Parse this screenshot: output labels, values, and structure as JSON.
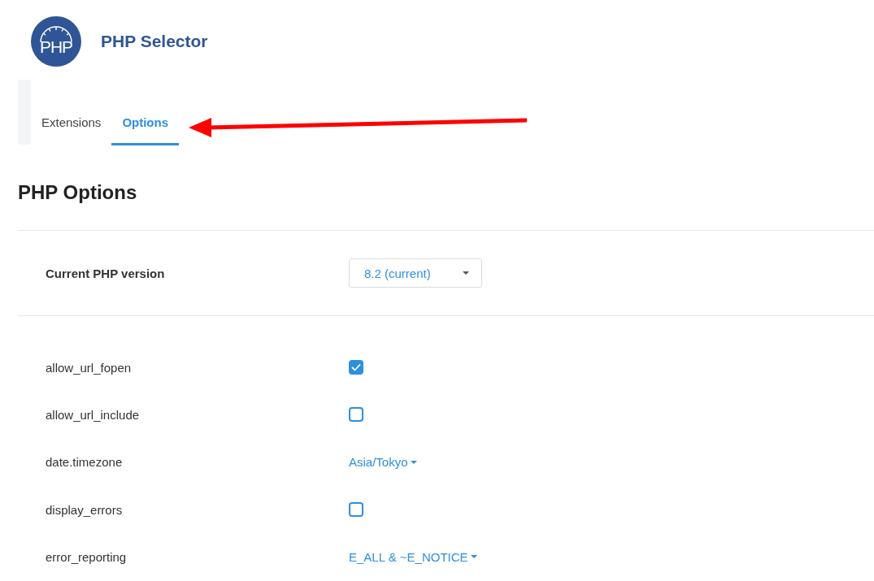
{
  "header": {
    "logo_text": "PHP",
    "title": "PHP Selector"
  },
  "tabs": [
    {
      "label": "Extensions",
      "selected": false
    },
    {
      "label": "Options",
      "selected": true
    }
  ],
  "section_title": "PHP Options",
  "version": {
    "label": "Current PHP version",
    "value": "8.2 (current)"
  },
  "options": [
    {
      "name": "allow_url_fopen",
      "kind": "checkbox",
      "checked": true
    },
    {
      "name": "allow_url_include",
      "kind": "checkbox",
      "checked": false
    },
    {
      "name": "date.timezone",
      "kind": "dropdown",
      "value": "Asia/Tokyo"
    },
    {
      "name": "display_errors",
      "kind": "checkbox",
      "checked": false
    },
    {
      "name": "error_reporting",
      "kind": "dropdown",
      "value": "E_ALL & ~E_NOTICE"
    }
  ]
}
